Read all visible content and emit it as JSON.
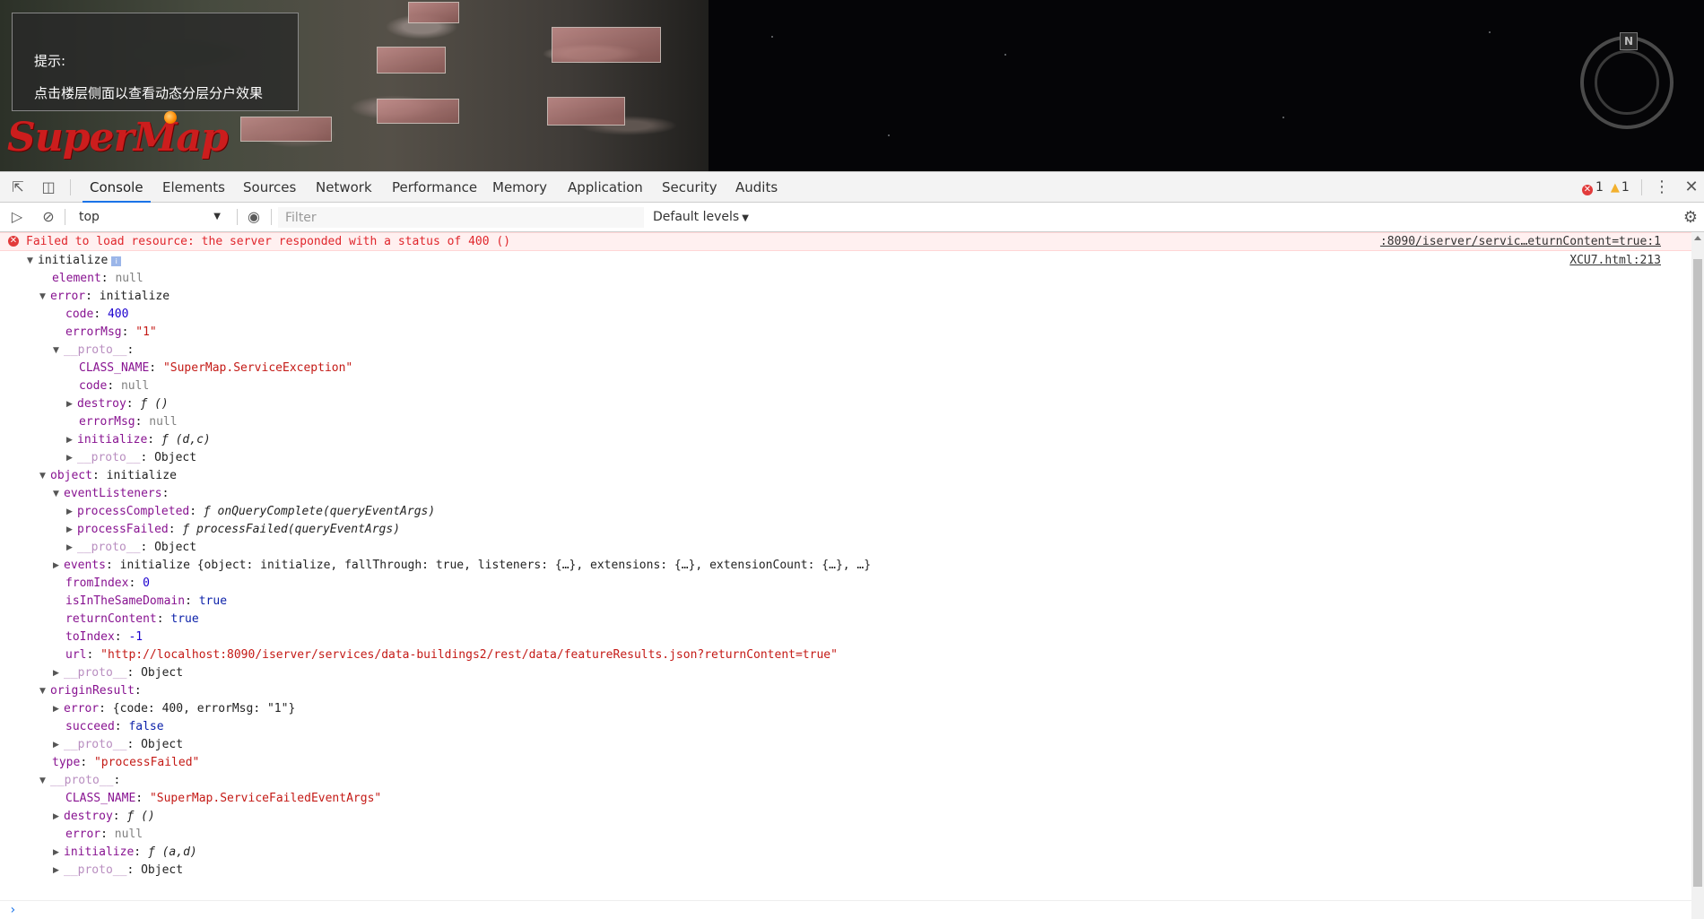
{
  "map": {
    "tip_title": "提示:",
    "tip_text": "点击楼层侧面以查看动态分层分户效果",
    "logo_text": "SuperMap",
    "compass_label": "N"
  },
  "devtools": {
    "tabs": [
      "Console",
      "Elements",
      "Sources",
      "Network",
      "Performance",
      "Memory",
      "Application",
      "Security",
      "Audits"
    ],
    "active_tab": "Console",
    "error_count": "1",
    "warning_count": "1",
    "context": "top",
    "filter_placeholder": "Filter",
    "levels": "Default levels"
  },
  "console": {
    "error": {
      "message": "Failed to load resource: the server responded with a status of 400 ()",
      "source": ":8090/iserver/servic…eturnContent=true:1"
    },
    "log_source": "XCU7.html:213",
    "tree": {
      "root": "initialize",
      "element_key": "element",
      "element_val": "null",
      "error_key": "error",
      "error_val": "initialize",
      "code_key": "code",
      "code_val": "400",
      "errormsg_key": "errorMsg",
      "errormsg_val": "\"1\"",
      "proto_key": "__proto__",
      "class_name_key": "CLASS_NAME",
      "class_name_val": "\"SuperMap.ServiceException\"",
      "code2_val": "null",
      "destroy_key": "destroy",
      "destroy_val": "ƒ ()",
      "errormsg2_val": "null",
      "init_key": "initialize",
      "init_val": "ƒ (d,c)",
      "object_val": "Object",
      "obj_key": "object",
      "obj_val": "initialize",
      "evl_key": "eventListeners",
      "pc_key": "processCompleted",
      "pc_val": "ƒ onQueryComplete(queryEventArgs)",
      "pf_key": "processFailed",
      "pf_val": "ƒ processFailed(queryEventArgs)",
      "events_key": "events",
      "events_val": "initialize {object: initialize, fallThrough: true, listeners: {…}, extensions: {…}, extensionCount: {…}, …}",
      "from_key": "fromIndex",
      "from_val": "0",
      "same_key": "isInTheSameDomain",
      "same_val": "true",
      "rc_key": "returnContent",
      "rc_val": "true",
      "to_key": "toIndex",
      "to_val": "-1",
      "url_key": "url",
      "url_val": "\"http://localhost:8090/iserver/services/data-buildings2/rest/data/featureResults.json?returnContent=true\"",
      "origin_key": "originResult",
      "origin_err_val": "{code: 400, errorMsg: \"1\"}",
      "succeed_key": "succeed",
      "succeed_val": "false",
      "type_key": "type",
      "type_val": "\"processFailed\"",
      "class2_val": "\"SuperMap.ServiceFailedEventArgs\"",
      "error2_val": "null",
      "init2_val": "ƒ (a,d)"
    }
  }
}
